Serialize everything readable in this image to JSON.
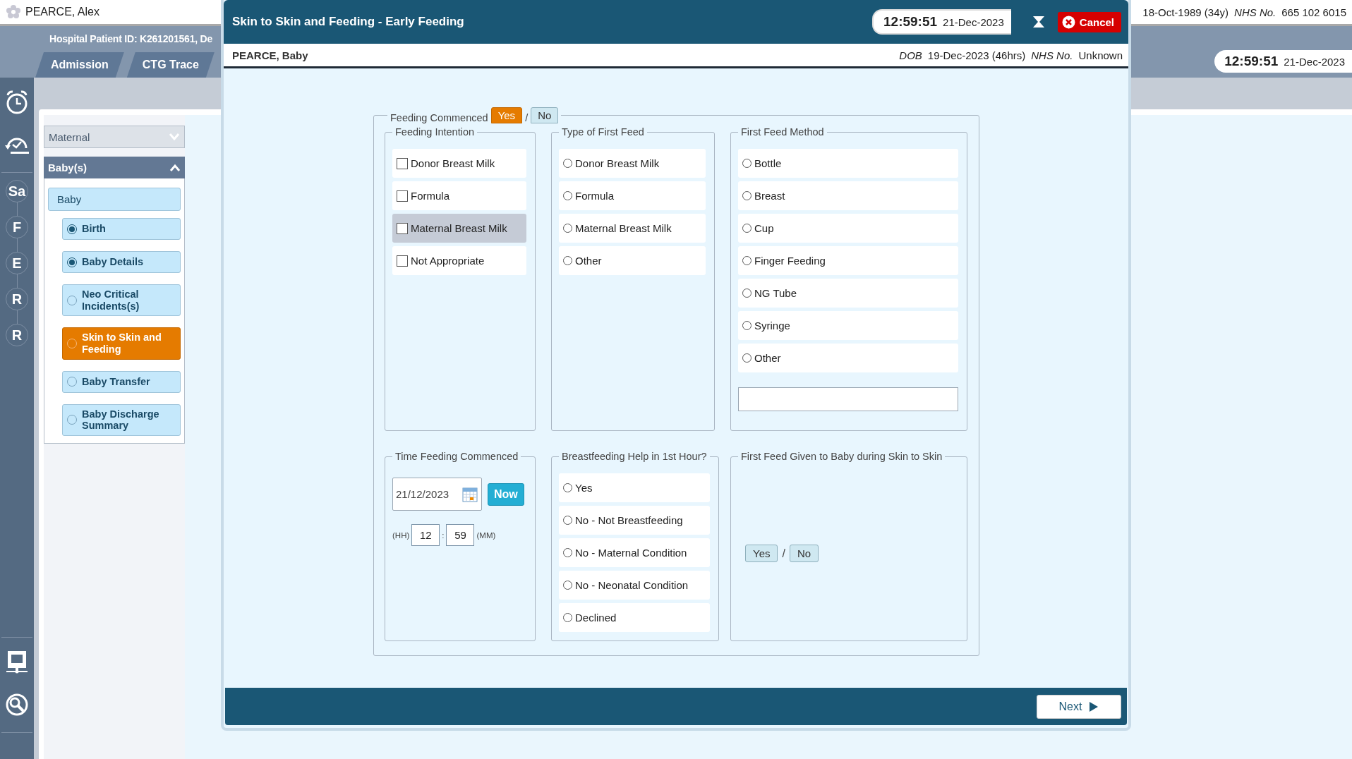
{
  "patient_bar": {
    "name": "PEARCE, Alex",
    "dob": "18-Oct-1989 (34y)",
    "nhs_label": "NHS No.",
    "nhs_number": "665 102 6015"
  },
  "header": {
    "patient_id": "Hospital Patient ID: K261201561, De",
    "tabs": [
      {
        "label": "Admission",
        "selected": false
      },
      {
        "label": "CTG Trace",
        "selected": false
      }
    ],
    "clock": {
      "time": "12:59:51",
      "date": "21-Dec-2023"
    }
  },
  "rail": {
    "steps": [
      "Sa",
      "F",
      "E",
      "R",
      "R"
    ]
  },
  "sidebar": {
    "dropdown": "Maternal",
    "section": {
      "title": "Baby(s)",
      "expanded": true
    },
    "group": "Baby",
    "items": [
      {
        "label": "Birth",
        "complete": true,
        "selected": false
      },
      {
        "label": "Baby Details",
        "complete": true,
        "selected": false
      },
      {
        "label": "Neo Critical Incidents(s)",
        "complete": false,
        "selected": false
      },
      {
        "label": "Skin to Skin and Feeding",
        "complete": false,
        "selected": true
      },
      {
        "label": "Baby Transfer",
        "complete": false,
        "selected": false
      },
      {
        "label": "Baby Discharge Summary",
        "complete": false,
        "selected": false
      }
    ]
  },
  "dialog": {
    "title": "Skin to Skin and Feeding - Early Feeding",
    "clock": {
      "time": "12:59:51",
      "date": "21-Dec-2023"
    },
    "cancel": "Cancel",
    "patient": {
      "name": "PEARCE, Baby",
      "dob_label": "DOB",
      "dob": "19-Dec-2023 (46hrs)",
      "nhs_label": "NHS No.",
      "nhs_number": "Unknown"
    },
    "feeding_commenced": {
      "label": "Feeding Commenced",
      "separator": "/",
      "options": [
        {
          "label": "Yes",
          "selected": true
        },
        {
          "label": "No",
          "selected": false
        }
      ]
    },
    "feeding_intention": {
      "legend": "Feeding Intention",
      "options": [
        {
          "label": "Donor Breast Milk",
          "checked": false,
          "highlighted": false
        },
        {
          "label": "Formula",
          "checked": false,
          "highlighted": false
        },
        {
          "label": "Maternal Breast Milk",
          "checked": false,
          "highlighted": true
        },
        {
          "label": "Not Appropriate",
          "checked": false,
          "highlighted": false
        }
      ]
    },
    "type_of_first_feed": {
      "legend": "Type of First Feed",
      "options": [
        {
          "label": "Donor Breast Milk",
          "selected": false
        },
        {
          "label": "Formula",
          "selected": false
        },
        {
          "label": "Maternal Breast Milk",
          "selected": false
        },
        {
          "label": "Other",
          "selected": false
        }
      ]
    },
    "first_feed_method": {
      "legend": "First Feed Method",
      "options": [
        {
          "label": "Bottle",
          "selected": false
        },
        {
          "label": "Breast",
          "selected": false
        },
        {
          "label": "Cup",
          "selected": false
        },
        {
          "label": "Finger Feeding",
          "selected": false
        },
        {
          "label": "NG Tube",
          "selected": false
        },
        {
          "label": "Syringe",
          "selected": false
        },
        {
          "label": "Other",
          "selected": false
        }
      ]
    },
    "time_feeding_commenced": {
      "legend": "Time Feeding Commenced",
      "date": "21/12/2023",
      "now_button": "Now",
      "hh_label": "(HH)",
      "hour": "12",
      "time_separator": ":",
      "minute": "59",
      "mm_label": "(MM)"
    },
    "breastfeeding_help": {
      "legend": "Breastfeeding Help in 1st Hour?",
      "options": [
        {
          "label": "Yes",
          "selected": false
        },
        {
          "label": "No - Not Breastfeeding",
          "selected": false
        },
        {
          "label": "No - Maternal Condition",
          "selected": false
        },
        {
          "label": "No - Neonatal Condition",
          "selected": false
        },
        {
          "label": "Declined",
          "selected": false
        }
      ]
    },
    "first_feed_during_skin": {
      "legend": "First Feed Given to Baby during Skin to Skin",
      "separator": "/",
      "options": [
        {
          "label": "Yes",
          "selected": false
        },
        {
          "label": "No",
          "selected": false
        }
      ]
    },
    "next": "Next"
  }
}
